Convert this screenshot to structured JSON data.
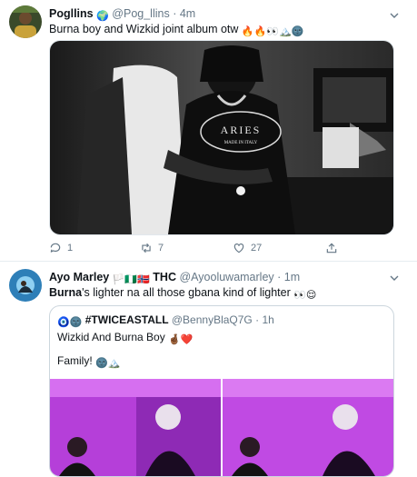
{
  "tweet1": {
    "name": "Pogllins",
    "handle": "@Pog_llins",
    "time": "4m",
    "sep": "·",
    "text": "Burna boy and Wizkid joint album otw",
    "name_emoji": "🌍",
    "text_emojis": "🔥🔥👀🏔️🌚",
    "shirt_brand": "ARIES",
    "shirt_sub": "MADE IN ITALY",
    "reply_count": "1",
    "retweet_count": "7",
    "like_count": "27"
  },
  "tweet2": {
    "name": "Ayo Marley",
    "flags": "🏳️🇳🇬🇳🇴",
    "name_suffix": "THC",
    "handle": "@Ayooluwamarley",
    "time": "1m",
    "sep": "·",
    "text_bold": "Burna",
    "text_rest": "'s lighter na all those gbana kind of lighter",
    "text_emojis": "👀😌"
  },
  "quoted": {
    "name_prefix_emojis": "🧿🌚",
    "name": "#TWICEASTALL",
    "handle": "@BennyBlaQ7G",
    "time": "1h",
    "sep": "·",
    "line1": "Wizkid And Burna Boy",
    "line1_emojis": "🤞🏾❤️",
    "line2": "Family!",
    "line2_emojis": "🌚🏔️"
  },
  "colors": {
    "link_blue": "#1da1f2",
    "muted": "#657786",
    "purple": "#b03ad8"
  },
  "icons": [
    "reply-icon",
    "retweet-icon",
    "like-icon",
    "share-icon",
    "caret-down-icon",
    "verified-globe-icon"
  ]
}
